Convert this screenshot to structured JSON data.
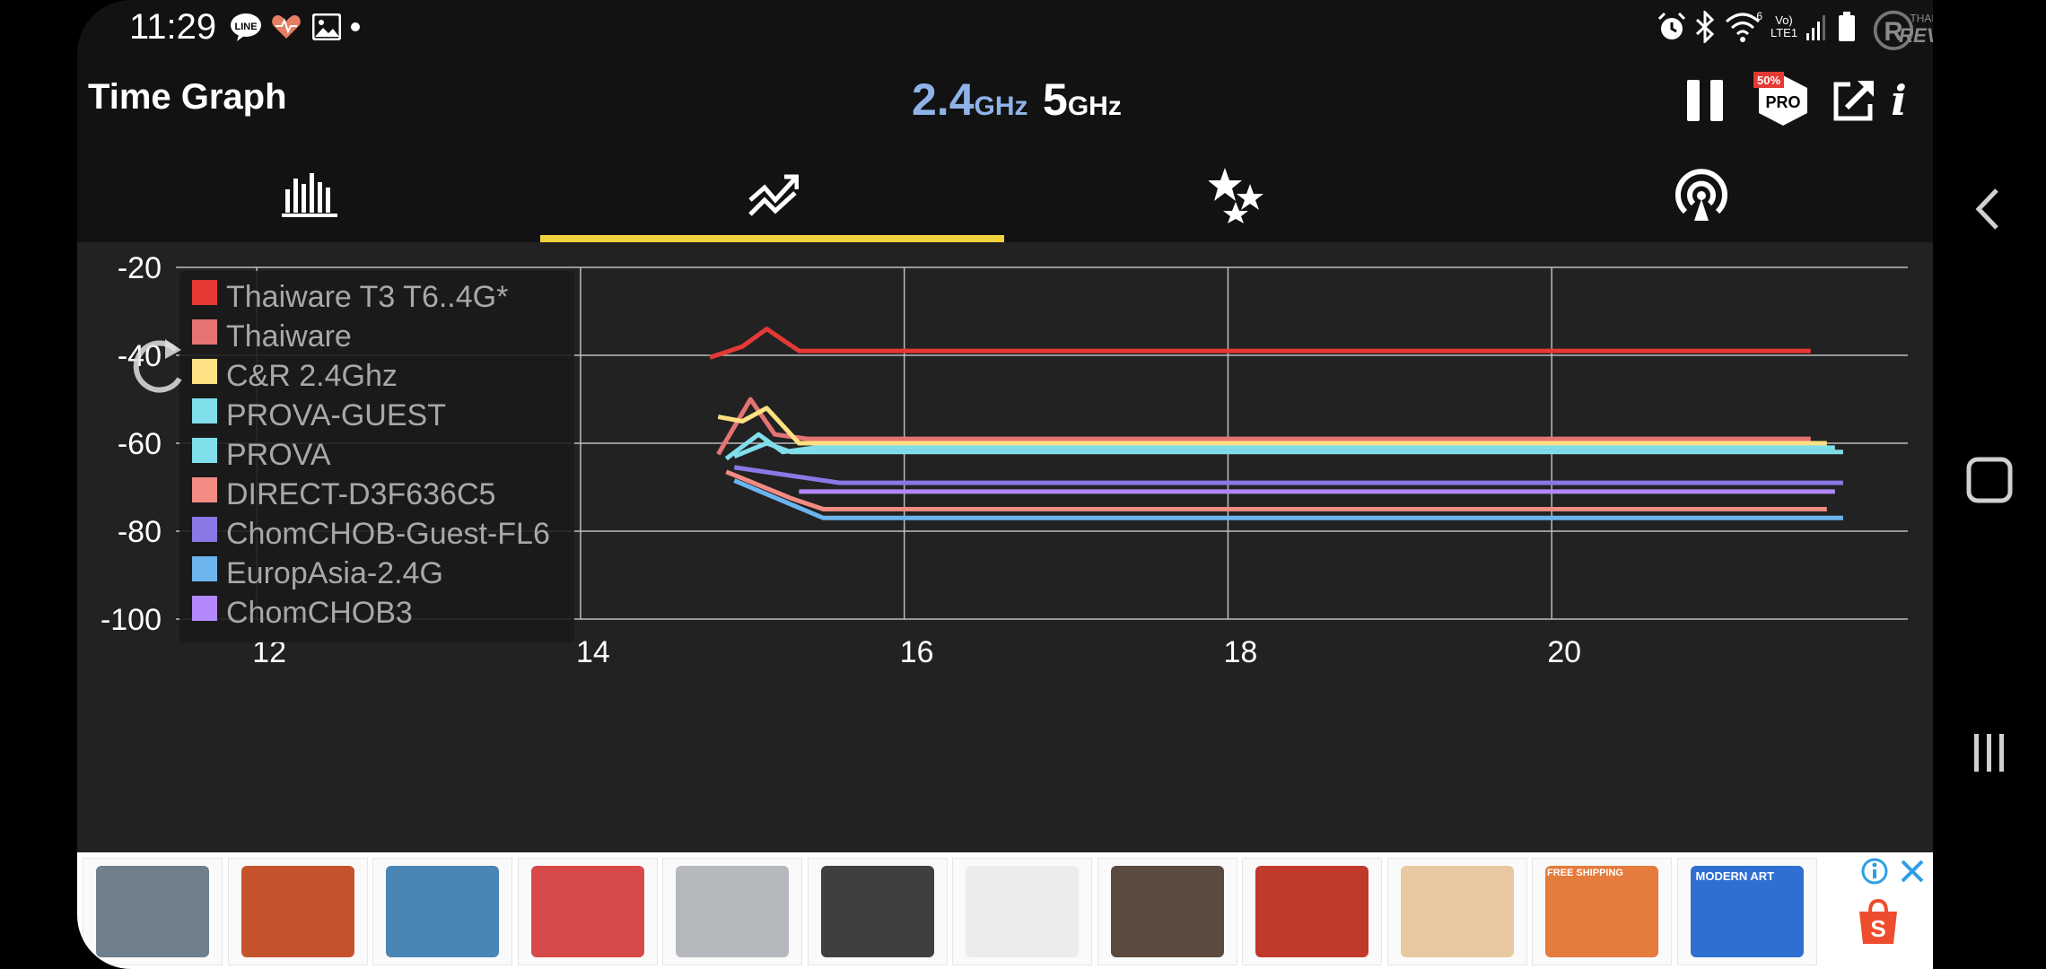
{
  "status_bar": {
    "time": "11:29",
    "notification_icons": [
      "line-icon",
      "heart-icon",
      "image-icon",
      "dot-icon"
    ],
    "system_icons": [
      "alarm-icon",
      "bluetooth-icon",
      "wifi-icon",
      "lte-icon",
      "signal-icon",
      "battery-icon"
    ],
    "wifi_label": "6",
    "lte_label": "Vo) LTE1"
  },
  "watermark": {
    "top": "THAIWARE",
    "bottom": "REVIEW"
  },
  "app": {
    "title": "Time Graph",
    "band_24_num": "2.4",
    "band_24_unit": "GHz",
    "band_5_num": "5",
    "band_5_unit": "GHz",
    "band_24_color": "#8fb2e8",
    "pro_badge": "PRO",
    "pro_discount": "50%",
    "info_label": "i"
  },
  "tabs": [
    {
      "name": "channel-graph",
      "icon": "bar-graph-icon"
    },
    {
      "name": "time-graph",
      "icon": "trend-icon",
      "selected": true
    },
    {
      "name": "channel-rating",
      "icon": "stars-icon"
    },
    {
      "name": "access-points",
      "icon": "signal-broadcast-icon"
    }
  ],
  "chart_data": {
    "type": "line",
    "xlabel": "",
    "ylabel": "",
    "x_ticks": [
      "12",
      "14",
      "16",
      "18",
      "20"
    ],
    "y_ticks": [
      "-20",
      "-40",
      "-60",
      "-80",
      "-100"
    ],
    "xlim": [
      11.5,
      22.2
    ],
    "ylim": [
      -100,
      -20
    ],
    "grid": true,
    "legend_placement": "top-left",
    "series": [
      {
        "name": "Thaiware T3 T6..4G*",
        "color": "#e53935",
        "points": [
          [
            14.8,
            -40.5
          ],
          [
            15.0,
            -38
          ],
          [
            15.15,
            -34
          ],
          [
            15.35,
            -39
          ],
          [
            21.6,
            -39
          ]
        ]
      },
      {
        "name": "Thaiware",
        "color": "#e57373",
        "points": [
          [
            14.85,
            -62.5
          ],
          [
            15.05,
            -50
          ],
          [
            15.2,
            -58
          ],
          [
            15.4,
            -59
          ],
          [
            21.6,
            -59
          ]
        ]
      },
      {
        "name": "C&R 2.4Ghz",
        "color": "#ffe082",
        "points": [
          [
            14.85,
            -54
          ],
          [
            15.0,
            -55
          ],
          [
            15.15,
            -52
          ],
          [
            15.35,
            -60
          ],
          [
            21.7,
            -60
          ]
        ]
      },
      {
        "name": "PROVA-GUEST",
        "color": "#80deea",
        "points": [
          [
            14.9,
            -63.5
          ],
          [
            15.1,
            -58
          ],
          [
            15.25,
            -62
          ],
          [
            15.45,
            -61
          ],
          [
            21.75,
            -61
          ]
        ]
      },
      {
        "name": "PROVA",
        "color": "#80deea",
        "points": [
          [
            14.95,
            -63
          ],
          [
            15.15,
            -60
          ],
          [
            15.3,
            -62
          ],
          [
            15.5,
            -62
          ],
          [
            21.8,
            -62
          ]
        ]
      },
      {
        "name": "DIRECT-D3F636C5",
        "color": "#f28b82",
        "points": [
          [
            14.9,
            -66.5
          ],
          [
            15.3,
            -72.5
          ],
          [
            15.5,
            -75
          ],
          [
            21.7,
            -75
          ]
        ]
      },
      {
        "name": "ChomCHOB-Guest-FL6",
        "color": "#8b78e6",
        "points": [
          [
            14.95,
            -65.5
          ],
          [
            15.6,
            -69
          ],
          [
            21.8,
            -69
          ]
        ]
      },
      {
        "name": "EuropAsia-2.4G",
        "color": "#6cb4ee",
        "points": [
          [
            14.95,
            -68.5
          ],
          [
            15.5,
            -77
          ],
          [
            21.8,
            -77
          ]
        ]
      },
      {
        "name": "ChomCHOB3",
        "color": "#b388ff",
        "points": [
          [
            15.35,
            -71
          ],
          [
            21.75,
            -71
          ]
        ]
      }
    ]
  },
  "ads": {
    "items": [
      {
        "name": "robot-toy",
        "bg": "#6f7f8c"
      },
      {
        "name": "game-box",
        "bg": "#c4532c"
      },
      {
        "name": "anime-figure",
        "bg": "#4a86b5"
      },
      {
        "name": "ring-fit",
        "bg": "#d84a4a"
      },
      {
        "name": "space-case",
        "bg": "#b5b8bd"
      },
      {
        "name": "console-accessory",
        "bg": "#3f3f3f"
      },
      {
        "name": "wii-accessory",
        "bg": "#ececec"
      },
      {
        "name": "itachi-figure",
        "bg": "#5b4a3f"
      },
      {
        "name": "red-model-car",
        "bg": "#c0392b"
      },
      {
        "name": "dice-set",
        "bg": "#e8c8a0"
      },
      {
        "name": "switch-games-free-shipping",
        "bg": "#e57b3c"
      },
      {
        "name": "modern-art-book",
        "bg": "#2f6fd2"
      }
    ],
    "free_shipping_label": "FREE SHIPPING",
    "modern_art_label": "MODERN ART",
    "shop_icon": "shopping-bag-icon"
  },
  "nav_bar": {
    "back": "back-icon",
    "home": "home-icon",
    "recents": "recents-icon"
  }
}
